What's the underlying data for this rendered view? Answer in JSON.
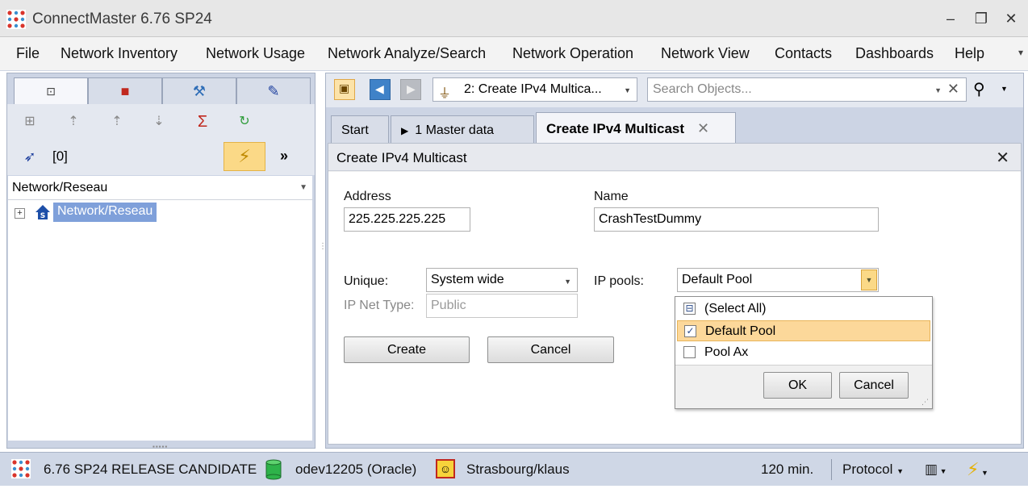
{
  "window": {
    "title": "ConnectMaster 6.76 SP24",
    "controls": [
      "–",
      "❐",
      "✕"
    ]
  },
  "menu": [
    "File",
    "Network Inventory",
    "Network Usage",
    "Network Analyze/Search",
    "Network Operation",
    "Network View",
    "Contacts",
    "Dashboards",
    "Help"
  ],
  "left_panel": {
    "count": "[0]",
    "more": "»",
    "combo_value": "Network/Reseau",
    "tree": {
      "expander": "+",
      "root_label": "Network/Reseau"
    }
  },
  "right_toolbar": {
    "nav_combo": "2: Create IPv4 Multica...",
    "search_placeholder": "Search Objects..."
  },
  "tabs": [
    {
      "label": "Start"
    },
    {
      "label": "1 Master data",
      "prefix": "▶"
    },
    {
      "label": "Create IPv4 Multicast",
      "close": "✕"
    }
  ],
  "form": {
    "title": "Create IPv4 Multicast",
    "address_label": "Address",
    "address_value": "225.225.225.225",
    "name_label": "Name",
    "name_value": "CrashTestDummy",
    "unique_label": "Unique:",
    "unique_value": "System wide",
    "ip_pools_label": "IP pools:",
    "ip_pools_value": "Default Pool",
    "ip_net_type_label": "IP Net Type:",
    "ip_net_type_value": "Public",
    "create_button": "Create",
    "cancel_button": "Cancel"
  },
  "pool_dropdown": {
    "items": [
      {
        "label": "(Select All)",
        "state": "partial"
      },
      {
        "label": "Default Pool",
        "state": "checked"
      },
      {
        "label": "Pool Ax",
        "state": "unchecked"
      }
    ],
    "ok_button": "OK",
    "cancel_button": "Cancel"
  },
  "statusbar": {
    "version": "6.76 SP24 RELEASE CANDIDATE",
    "database": "odev12205 (Oracle)",
    "location": "Strasbourg/klaus",
    "timeout": "120 min.",
    "protocol": "Protocol"
  },
  "colors": {
    "accent_orange": "#fbd987",
    "panel_blue": "#ccd4e4",
    "selection_blue": "#7fa0da"
  }
}
